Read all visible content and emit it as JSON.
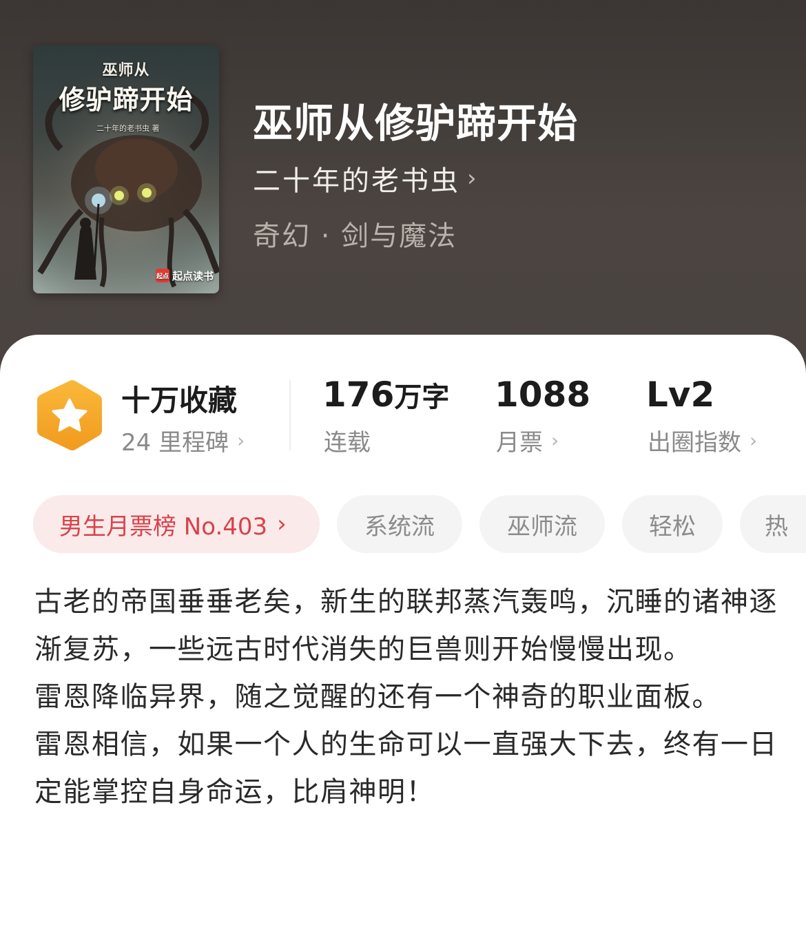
{
  "cover": {
    "small_title": "巫师从",
    "title": "修驴蹄开始",
    "author": "二十年的老书虫 著",
    "brand_logo": "起点",
    "brand": "起点读书"
  },
  "book": {
    "title": "巫师从修驴蹄开始",
    "author": "二十年的老书虫",
    "genre": "奇幻 · 剑与魔法"
  },
  "stats": {
    "collection": {
      "main": "十万收藏",
      "sub": "24 里程碑"
    },
    "words": {
      "number": "176",
      "unit": "万字",
      "sub": "连载"
    },
    "monthly": {
      "main": "1088",
      "sub": "月票"
    },
    "level": {
      "main": "Lv2",
      "sub": "出圈指数"
    }
  },
  "tags": {
    "rank": "男生月票榜 No.403",
    "items": [
      "系统流",
      "巫师流",
      "轻松",
      "热"
    ]
  },
  "description": [
    "古老的帝国垂垂老矣，新生的联邦蒸汽轰鸣，沉睡的诸神逐渐复苏，一些远古时代消失的巨兽则开始慢慢出现。",
    "雷恩降临异界，随之觉醒的还有一个神奇的职业面板。",
    "雷恩相信，如果一个人的生命可以一直强大下去，终有一日定能掌控自身命运，比肩神明！"
  ],
  "colors": {
    "header_bg": "#4a4340",
    "badge": "#f5a623",
    "rank_tag_text": "#d8424a",
    "rank_tag_bg": "#fbeaea"
  },
  "icons": {
    "badge": "star-hexagon-icon",
    "chevron": "chevron-right-icon"
  }
}
